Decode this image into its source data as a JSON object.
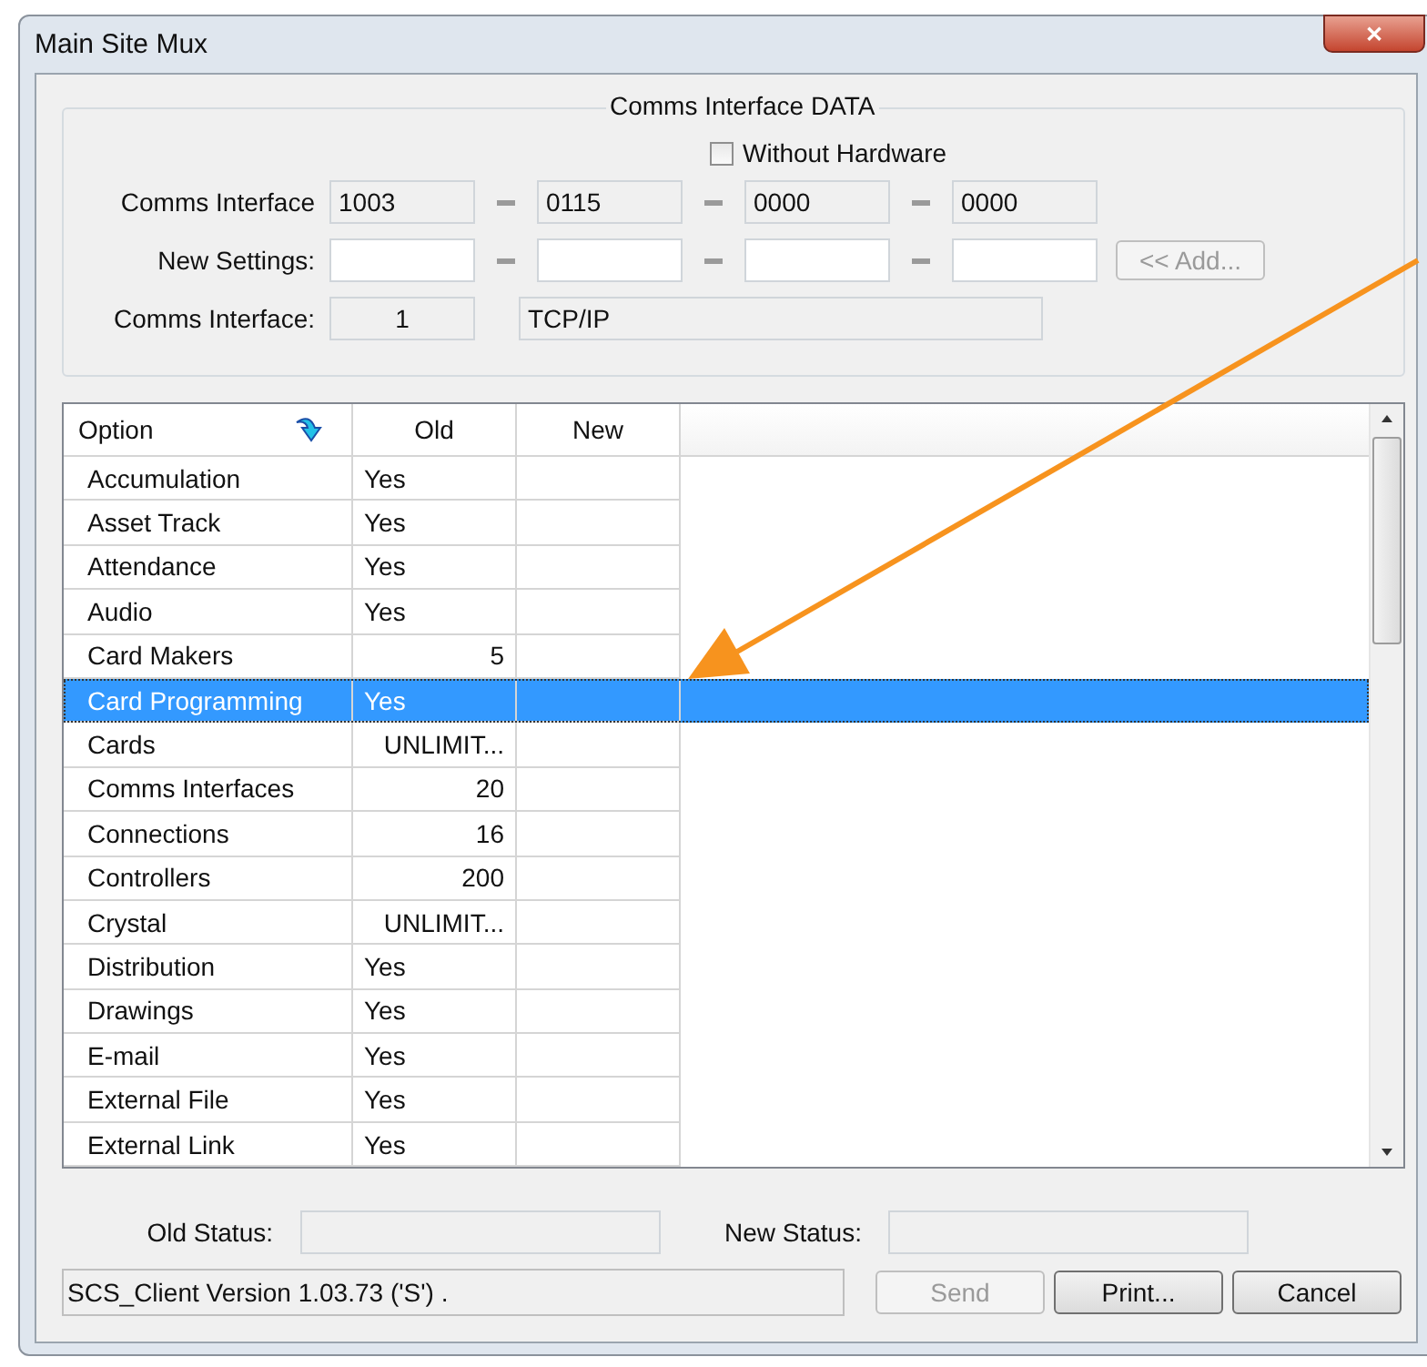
{
  "window": {
    "title": "Main Site Mux",
    "close": "✕"
  },
  "group": {
    "title": "Comms Interface DATA",
    "without_hardware": {
      "label": "Without Hardware",
      "checked": false
    },
    "comms_interface": {
      "label": "Comms Interface",
      "values": [
        "1003",
        "0115",
        "0000",
        "0000"
      ]
    },
    "new_settings": {
      "label": "New Settings:",
      "add_button": {
        "label": "<< Add...",
        "disabled": true
      }
    },
    "comms_interface_type": {
      "label": "Comms Interface:",
      "number": "1",
      "type": "TCP/IP"
    }
  },
  "table": {
    "columns": [
      "Option",
      "Old",
      "New"
    ],
    "rows": [
      {
        "option": "Accumulation",
        "old": "Yes",
        "kind": "flag",
        "selected": false
      },
      {
        "option": "Asset Track",
        "old": "Yes",
        "kind": "flag",
        "selected": false
      },
      {
        "option": "Attendance",
        "old": "Yes",
        "kind": "flag",
        "selected": false
      },
      {
        "option": "Audio",
        "old": "Yes",
        "kind": "flag",
        "selected": false
      },
      {
        "option": "Card Makers",
        "old": "5",
        "kind": "number",
        "selected": false
      },
      {
        "option": "Card Programming",
        "old": "Yes",
        "kind": "flag",
        "selected": true
      },
      {
        "option": "Cards",
        "old": "UNLIMIT...",
        "kind": "number",
        "selected": false
      },
      {
        "option": "Comms Interfaces",
        "old": "20",
        "kind": "number",
        "selected": false
      },
      {
        "option": "Connections",
        "old": "16",
        "kind": "number",
        "selected": false
      },
      {
        "option": "Controllers",
        "old": "200",
        "kind": "number",
        "selected": false
      },
      {
        "option": "Crystal",
        "old": "UNLIMIT...",
        "kind": "number",
        "selected": false
      },
      {
        "option": "Distribution",
        "old": "Yes",
        "kind": "flag",
        "selected": false
      },
      {
        "option": "Drawings",
        "old": "Yes",
        "kind": "flag",
        "selected": false
      },
      {
        "option": "E-mail",
        "old": "Yes",
        "kind": "flag",
        "selected": false
      },
      {
        "option": "External File",
        "old": "Yes",
        "kind": "flag",
        "selected": false
      },
      {
        "option": "External Link",
        "old": "Yes",
        "kind": "flag",
        "selected": false
      }
    ]
  },
  "old_status": {
    "label": "Old Status:"
  },
  "new_status": {
    "label": "New Status:"
  },
  "status_bar": "SCS_Client Version 1.03.73 ('S') .",
  "buttons": [
    {
      "label": "Send",
      "disabled": true
    },
    {
      "label": "Print...",
      "disabled": false
    },
    {
      "label": "Cancel",
      "disabled": false
    }
  ]
}
